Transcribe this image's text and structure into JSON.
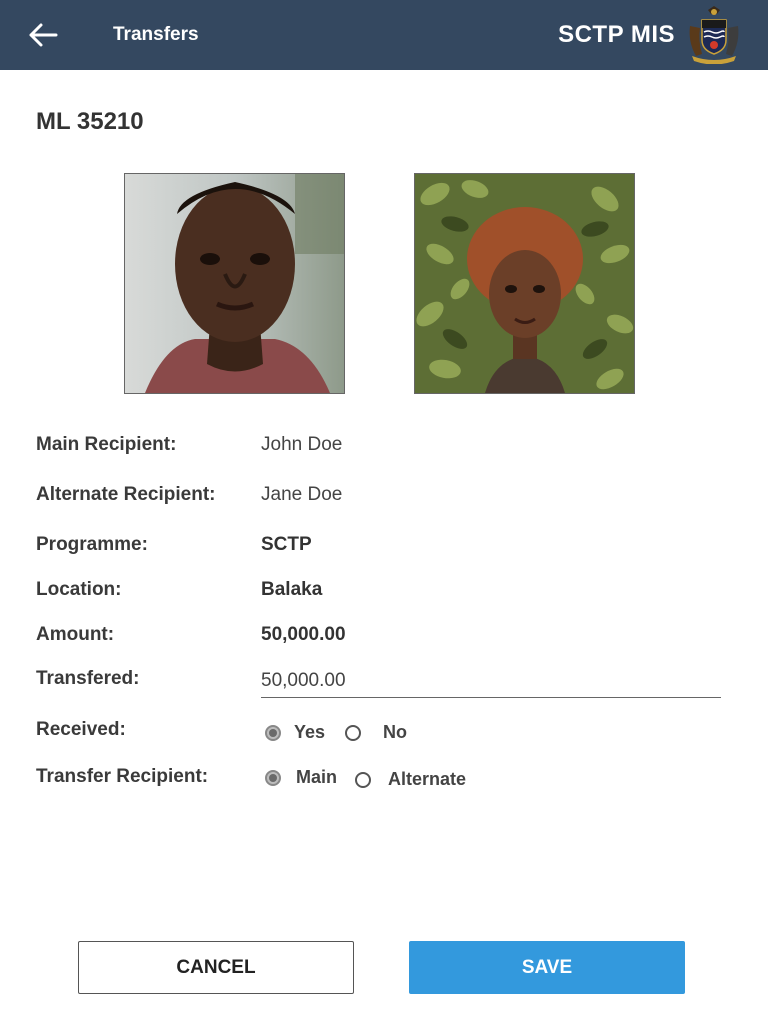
{
  "appbar": {
    "title": "Transfers",
    "app_name": "SCTP MIS",
    "back_icon": "arrow-left-icon",
    "emblem": "malawi-coat-of-arms-icon",
    "background": "#344860"
  },
  "record": {
    "id": "ML 35210"
  },
  "fields": {
    "main_recipient": {
      "label": "Main Recipient:",
      "value": "John Doe"
    },
    "alternate_recipient": {
      "label": "Alternate Recipient:",
      "value": "Jane Doe"
    },
    "programme": {
      "label": "Programme:",
      "value": "SCTP"
    },
    "location": {
      "label": "Location:",
      "value": "Balaka"
    },
    "amount": {
      "label": "Amount:",
      "value": "50,000.00"
    },
    "transfered": {
      "label": "Transfered:",
      "value": "50,000.00"
    },
    "received": {
      "label": "Received:",
      "options": [
        {
          "label": "Yes",
          "checked": true
        },
        {
          "label": "No",
          "checked": false
        }
      ]
    },
    "transfer_recipient": {
      "label": "Transfer Recipient:",
      "options": [
        {
          "label": "Main",
          "checked": true
        },
        {
          "label": "Alternate",
          "checked": false
        }
      ]
    }
  },
  "actions": {
    "cancel_label": "CANCEL",
    "save_label": "SAVE",
    "save_color": "#3399dd"
  }
}
